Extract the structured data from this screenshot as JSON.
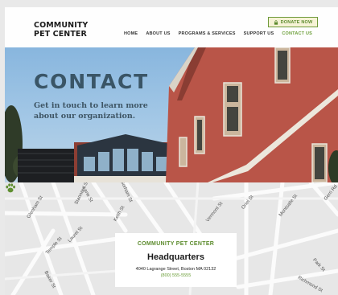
{
  "header": {
    "logo_line1": "COMMUNITY",
    "logo_line2": "PET CENTER",
    "donate_label": "DONATE NOW",
    "nav": [
      {
        "label": "HOME"
      },
      {
        "label": "ABOUT US"
      },
      {
        "label": "PROGRAMS & SERVICES"
      },
      {
        "label": "SUPPORT US"
      },
      {
        "label": "CONTACT US",
        "active": true
      }
    ]
  },
  "hero": {
    "title": "CONTACT",
    "subtitle": "Get in touch to learn more about our organization."
  },
  "map": {
    "streets": [
      "Glenham St",
      "Stannard St",
      "Laurel St",
      "Temple St",
      "Lane St",
      "Gorham St",
      "Keith St",
      "Vermont St",
      "Oriel St",
      "Montsalle St",
      "Baker St",
      "Richmond St",
      "Park St",
      "Gerri Rd"
    ],
    "card": {
      "org": "COMMUNITY PET CENTER",
      "title": "Headquarters",
      "address": "4040 Lagrange Street, Boston MA 02132",
      "phone": "(800) 555-5555"
    }
  },
  "colors": {
    "accent_green": "#6b9e38",
    "donate_bg": "#f6f3d6",
    "hero_title": "#3a5566"
  }
}
